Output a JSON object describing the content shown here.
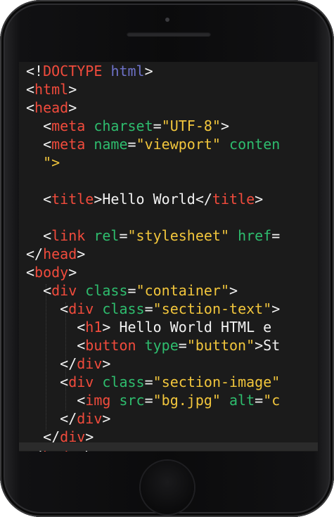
{
  "code": {
    "lines": [
      [
        [
          "t",
          "<!"
        ],
        [
          "k",
          "DOCTYPE"
        ],
        [
          "s",
          " "
        ],
        [
          "d",
          "html"
        ],
        [
          "t",
          ">"
        ]
      ],
      [
        [
          "t",
          "<"
        ],
        [
          "k",
          "html"
        ],
        [
          "t",
          ">"
        ]
      ],
      [
        [
          "t",
          "<"
        ],
        [
          "k",
          "head"
        ],
        [
          "t",
          ">"
        ]
      ],
      [
        [
          "t",
          "  <"
        ],
        [
          "k",
          "meta"
        ],
        [
          "s",
          " "
        ],
        [
          "a",
          "charset"
        ],
        [
          "t",
          "="
        ],
        [
          "v",
          "\"UTF-8\""
        ],
        [
          "t",
          ">"
        ]
      ],
      [
        [
          "t",
          "  <"
        ],
        [
          "k",
          "meta"
        ],
        [
          "s",
          " "
        ],
        [
          "a",
          "name"
        ],
        [
          "t",
          "="
        ],
        [
          "v",
          "\"viewport\""
        ],
        [
          "s",
          " "
        ],
        [
          "a",
          "conten"
        ]
      ],
      [
        [
          "v",
          "  \">"
        ]
      ],
      [],
      [
        [
          "t",
          "  <"
        ],
        [
          "k",
          "title"
        ],
        [
          "t",
          ">Hello World</"
        ],
        [
          "k",
          "title"
        ],
        [
          "t",
          ">"
        ]
      ],
      [],
      [
        [
          "t",
          "  <"
        ],
        [
          "k",
          "link"
        ],
        [
          "s",
          " "
        ],
        [
          "a",
          "rel"
        ],
        [
          "t",
          "="
        ],
        [
          "v",
          "\"stylesheet\""
        ],
        [
          "s",
          " "
        ],
        [
          "a",
          "href"
        ],
        [
          "t",
          "="
        ]
      ],
      [
        [
          "t",
          "</"
        ],
        [
          "k",
          "head"
        ],
        [
          "t",
          ">"
        ]
      ],
      [
        [
          "t",
          "<"
        ],
        [
          "k",
          "body"
        ],
        [
          "t",
          ">"
        ]
      ],
      [
        [
          "t",
          "  <"
        ],
        [
          "k",
          "div"
        ],
        [
          "s",
          " "
        ],
        [
          "a",
          "class"
        ],
        [
          "t",
          "="
        ],
        [
          "v",
          "\"container\""
        ],
        [
          "t",
          ">"
        ]
      ],
      [
        [
          "t",
          "    <"
        ],
        [
          "k",
          "div"
        ],
        [
          "s",
          " "
        ],
        [
          "a",
          "class"
        ],
        [
          "t",
          "="
        ],
        [
          "v",
          "\"section-text\""
        ],
        [
          "t",
          ">"
        ]
      ],
      [
        [
          "t",
          "      <"
        ],
        [
          "k",
          "h1"
        ],
        [
          "t",
          "> Hello World HTML e"
        ]
      ],
      [
        [
          "t",
          "      <"
        ],
        [
          "k",
          "button"
        ],
        [
          "s",
          " "
        ],
        [
          "a",
          "type"
        ],
        [
          "t",
          "="
        ],
        [
          "v",
          "\"button\""
        ],
        [
          "t",
          ">St"
        ]
      ],
      [
        [
          "t",
          "    </"
        ],
        [
          "k",
          "div"
        ],
        [
          "t",
          ">"
        ]
      ],
      [
        [
          "t",
          "    <"
        ],
        [
          "k",
          "div"
        ],
        [
          "s",
          " "
        ],
        [
          "a",
          "class"
        ],
        [
          "t",
          "="
        ],
        [
          "v",
          "\"section-image\""
        ]
      ],
      [
        [
          "t",
          "      <"
        ],
        [
          "k",
          "img"
        ],
        [
          "s",
          " "
        ],
        [
          "a",
          "src"
        ],
        [
          "t",
          "="
        ],
        [
          "v",
          "\"bg.jpg\""
        ],
        [
          "s",
          " "
        ],
        [
          "a",
          "alt"
        ],
        [
          "t",
          "="
        ],
        [
          "v",
          "\"c"
        ]
      ],
      [
        [
          "t",
          "    </"
        ],
        [
          "k",
          "div"
        ],
        [
          "t",
          ">"
        ]
      ],
      [
        [
          "t",
          "  </"
        ],
        [
          "k",
          "div"
        ],
        [
          "t",
          ">"
        ]
      ],
      [
        [
          "t",
          "</"
        ],
        [
          "k",
          "body"
        ],
        [
          "t",
          ">"
        ]
      ]
    ]
  },
  "colors": {
    "tag": "#f14b3c",
    "doctype_keyword": "#6e72c8",
    "attribute": "#2ebd6e",
    "string": "#f2c63c",
    "text": "#f2f2f2",
    "editor_background": "#1b1b1b"
  }
}
